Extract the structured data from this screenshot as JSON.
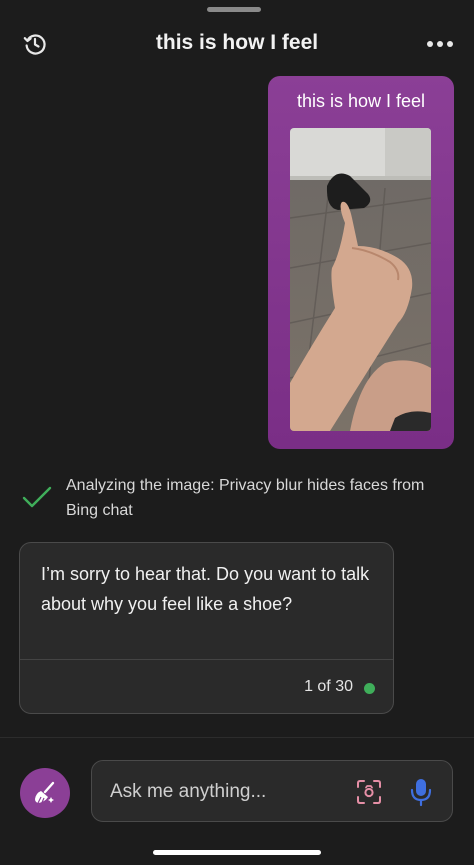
{
  "header": {
    "title": "this is how I feel",
    "history_icon": "history-clock-icon",
    "more_icon": "more-horizontal-icon"
  },
  "user_message": {
    "text": "this is how I feel",
    "attachment_icon": "attached-photo"
  },
  "analysis": {
    "icon": "checkmark-icon",
    "text": "Analyzing the image: Privacy blur hides faces from Bing chat"
  },
  "bot_message": {
    "text": "I’m sorry to hear that. Do you want to talk about why you feel like a shoe?",
    "turn_counter": "1 of 30",
    "status_color": "#3fae5a"
  },
  "composer": {
    "placeholder": "Ask me anything...",
    "new_topic_icon": "broom-icon",
    "camera_icon": "visual-search-icon",
    "mic_icon": "microphone-icon"
  },
  "colors": {
    "accent": "#8b3f96",
    "background": "#1c1c1c",
    "mic": "#3f6fe0"
  }
}
